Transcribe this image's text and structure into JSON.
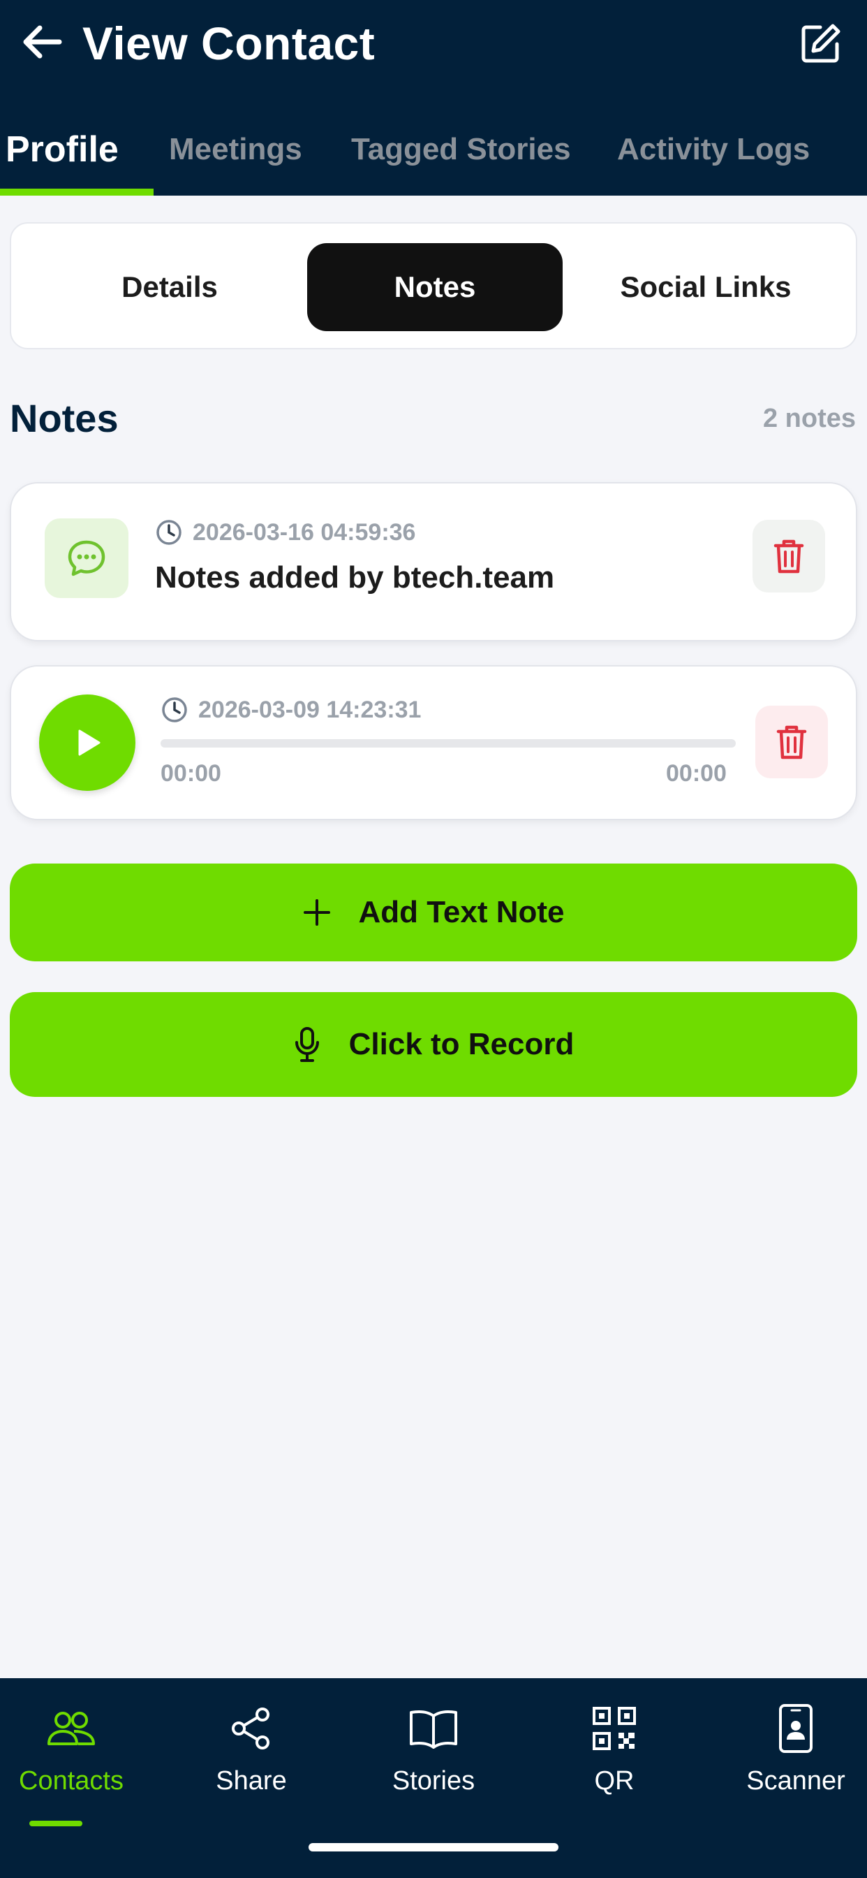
{
  "header": {
    "title": "View Contact"
  },
  "top_tabs": [
    {
      "label": "Profile",
      "active": true
    },
    {
      "label": "Meetings",
      "active": false
    },
    {
      "label": "Tagged Stories",
      "active": false
    },
    {
      "label": "Activity Logs",
      "active": false
    }
  ],
  "segments": [
    {
      "label": "Details",
      "active": false
    },
    {
      "label": "Notes",
      "active": true
    },
    {
      "label": "Social Links",
      "active": false
    }
  ],
  "notes_section": {
    "title": "Notes",
    "count": "2 notes"
  },
  "notes": [
    {
      "type": "text",
      "icon": "chat-bubble-icon",
      "timestamp": "2026-03-16 04:59:36",
      "text": "Notes added by btech.team"
    },
    {
      "type": "audio",
      "icon": "play-icon",
      "timestamp": "2026-03-09 14:23:31",
      "elapsed": "00:00",
      "duration": "00:00",
      "progress": 0
    }
  ],
  "actions": {
    "add_text_note": "Add Text Note",
    "record": "Click to Record"
  },
  "bottom_nav": [
    {
      "label": "Contacts",
      "icon": "contacts-icon",
      "active": true
    },
    {
      "label": "Share",
      "icon": "share-icon",
      "active": false
    },
    {
      "label": "Stories",
      "icon": "book-icon",
      "active": false
    },
    {
      "label": "QR",
      "icon": "qr-code-icon",
      "active": false
    },
    {
      "label": "Scanner",
      "icon": "scanner-icon",
      "active": false
    }
  ],
  "colors": {
    "header_bg": "#02203a",
    "accent_green": "#6fdc00",
    "delete_red": "#e0313e",
    "page_bg": "#f4f5f9"
  }
}
